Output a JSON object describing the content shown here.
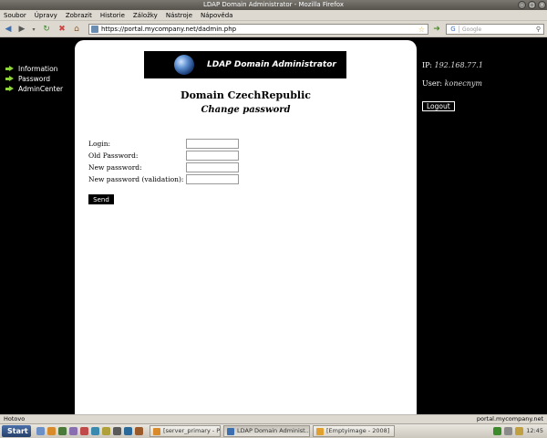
{
  "window": {
    "title": "LDAP Domain Administrator - Mozilla Firefox"
  },
  "menu": [
    "Soubor",
    "Úpravy",
    "Zobrazit",
    "Historie",
    "Záložky",
    "Nástroje",
    "Nápověda"
  ],
  "nav": {
    "url": "https://portal.mycompany.net/dadmin.php",
    "search_placeholder": "Google"
  },
  "sidebar": {
    "items": [
      {
        "label": "Information"
      },
      {
        "label": "Password"
      },
      {
        "label": "AdminCenter"
      }
    ]
  },
  "banner": {
    "title": "LDAP Domain Administrator"
  },
  "page": {
    "domain_title": "Domain CzechRepublic",
    "subtitle": "Change password"
  },
  "form": {
    "fields": [
      {
        "label": "Login:",
        "value": ""
      },
      {
        "label": "Old Password:",
        "value": ""
      },
      {
        "label": "New password:",
        "value": ""
      },
      {
        "label": "New password (validation):",
        "value": ""
      }
    ],
    "submit_label": "Send"
  },
  "info": {
    "ip_label": "IP:",
    "ip_value": "192.168.77.1",
    "user_label": "User:",
    "user_value": "konecnym",
    "logout_label": "Logout"
  },
  "statusbar": {
    "left": "Hotovo",
    "right": "portal.mycompany.net"
  },
  "taskbar": {
    "start_label": "Start",
    "tasks": [
      {
        "label": "[server_primary - Prohl..."
      },
      {
        "label": "LDAP Domain Administ..."
      },
      {
        "label": "[Emptyimage - 2008]"
      }
    ],
    "clock": "12:45"
  },
  "colors": {
    "accent_arrow": "#8fd33b",
    "page_bg": "#000000",
    "panel_bg": "#ffffff"
  }
}
